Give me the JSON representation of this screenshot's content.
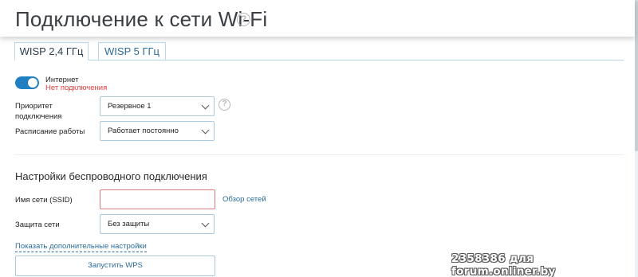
{
  "header": {
    "title": "Подключение к сети Wi-Fi",
    "help_glyph": "?"
  },
  "tabs": [
    {
      "label": "WISP 2,4 ГГц",
      "active": true
    },
    {
      "label": "WISP 5 ГГц",
      "active": false
    }
  ],
  "internet": {
    "label": "Интернет",
    "status": "Нет подключения",
    "enabled": true,
    "status_color": "#e23d3d"
  },
  "priority": {
    "label_line1": "Приоритет",
    "label_line2": "подключения",
    "value": "Резервное 1",
    "help_glyph": "?"
  },
  "schedule": {
    "label": "Расписание работы",
    "value": "Работает постоянно"
  },
  "wireless": {
    "title": "Настройки беспроводного подключения",
    "ssid_label": "Имя сети (SSID)",
    "ssid_value": "",
    "scan_link": "Обзор сетей",
    "security_label": "Защита сети",
    "security_value": "Без защиты",
    "advanced_link": "Показать дополнительные настройки",
    "wps_button": "Запустить WPS"
  },
  "watermark": "2358386 для forum.onliner.by",
  "colors": {
    "accent": "#1f7fc0",
    "link": "#2d6d99",
    "error": "#e23d3d",
    "border": "#a8c9df"
  },
  "icons": {
    "dropdown": "chevron-down-icon",
    "help": "help-circle-icon"
  }
}
